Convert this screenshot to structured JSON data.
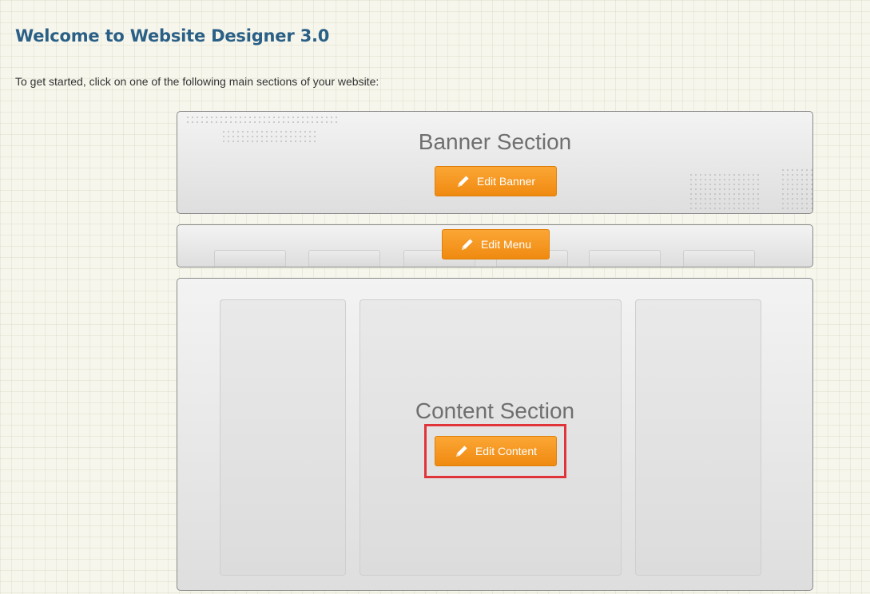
{
  "header": {
    "title": "Welcome to Website Designer 3.0",
    "intro": "To get started, click on one of the following main sections of your website:"
  },
  "banner": {
    "title": "Banner Section",
    "button_label": "Edit Banner",
    "button_icon": "pencil-icon"
  },
  "menu": {
    "button_label": "Edit Menu",
    "button_icon": "pencil-icon"
  },
  "content": {
    "title": "Content Section",
    "button_label": "Edit Content",
    "button_icon": "pencil-icon"
  },
  "colors": {
    "title": "#2a5f86",
    "button": "#f39a1e",
    "highlight": "#e0343a",
    "background": "#f6f6ec"
  }
}
